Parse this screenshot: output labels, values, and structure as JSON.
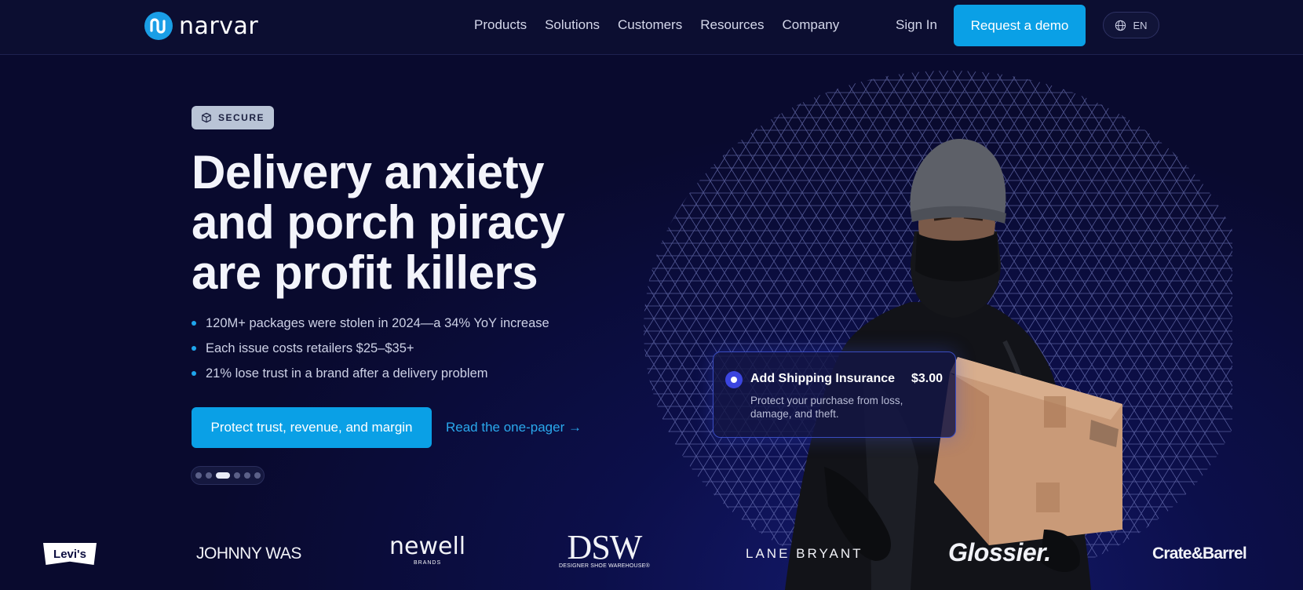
{
  "header": {
    "logo_text": "narvar",
    "nav": [
      "Products",
      "Solutions",
      "Customers",
      "Resources",
      "Company"
    ],
    "sign_in": "Sign In",
    "demo_button": "Request a demo",
    "language": "EN"
  },
  "hero": {
    "badge": "SECURE",
    "headline": [
      "Delivery anxiety",
      "and porch piracy",
      "are profit killers"
    ],
    "bullets": [
      "120M+ packages were stolen in 2024—a 34% YoY increase",
      "Each issue costs retailers $25–$35+",
      "21% lose trust in a brand after a delivery problem"
    ],
    "cta": "Protect trust, revenue, and margin",
    "link": "Read the one-pager →",
    "carousel": {
      "total": 6,
      "active": 2
    }
  },
  "insurance_card": {
    "title": "Add Shipping Insurance",
    "price": "$3.00",
    "description": "Protect your purchase from loss, damage, and theft."
  },
  "logos": {
    "levis": "Levi's",
    "johnny_was": "JOHNNY WAS",
    "newell": "newell",
    "newell_sub": "BRANDS",
    "dsw": "DSW",
    "dsw_sub": "DESIGNER SHOE WAREHOUSE®",
    "lane_bryant": "LANE BRYANT",
    "glossier": "Glossier.",
    "crate_barrel": "Crate&Barrel"
  },
  "colors": {
    "accent": "#0aa0e6",
    "background": "#0b0c35",
    "card_border": "#3a4cc0"
  }
}
